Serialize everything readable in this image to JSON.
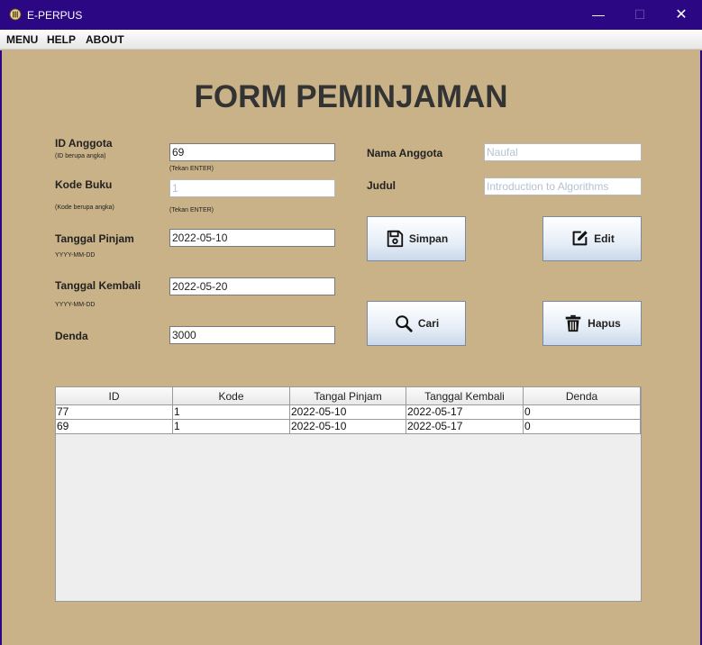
{
  "window": {
    "title": "E-PERPUS",
    "minimize": "—",
    "maximize": "☐",
    "close": "✕"
  },
  "menu": [
    "MENU",
    "HELP",
    "ABOUT"
  ],
  "form": {
    "title": "FORM PEMINJAMAN",
    "id_anggota_label": "ID Anggota",
    "id_anggota_hint": "(ID berupa angka)",
    "id_anggota_value": "69",
    "enter_hint": "(Tekan ENTER)",
    "kode_buku_label": "Kode Buku",
    "kode_buku_hint": "(Kode berupa angka)",
    "kode_buku_value": "1",
    "tanggal_pinjam_label": "Tanggal Pinjam",
    "date_format": "YYYY-MM-DD",
    "tanggal_pinjam_value": "2022-05-10",
    "tanggal_kembali_label": "Tanggal Kembali",
    "tanggal_kembali_value": "2022-05-20",
    "denda_label": "Denda",
    "denda_value": "3000",
    "nama_anggota_label": "Nama Anggota",
    "nama_anggota_value": "Naufal",
    "judul_label": "Judul",
    "judul_value": "Introduction to Algorithms"
  },
  "buttons": {
    "simpan": "Simpan",
    "edit": "Edit",
    "cari": "Cari",
    "hapus": "Hapus"
  },
  "table": {
    "headers": [
      "ID",
      "Kode",
      "Tangal Pinjam",
      "Tanggal Kembali",
      "Denda"
    ],
    "rows": [
      [
        "77",
        "1",
        "2022-05-10",
        "2022-05-17",
        "0"
      ],
      [
        "69",
        "1",
        "2022-05-10",
        "2022-05-17",
        "0"
      ]
    ]
  }
}
